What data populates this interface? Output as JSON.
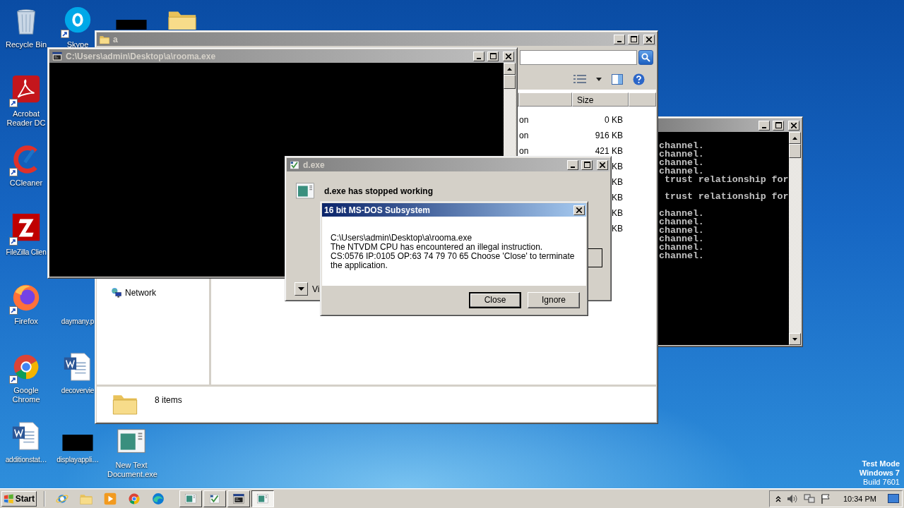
{
  "desktop_icons": [
    {
      "kind": "recycle",
      "label": "Recycle Bin",
      "shortcut": false
    },
    {
      "kind": "skype",
      "label": "Skype",
      "shortcut": true
    },
    {
      "kind": "redacted",
      "shortcut": false
    },
    {
      "kind": "folder",
      "shortcut": false
    },
    {
      "kind": "acrobat",
      "label": "Acrobat Reader DC",
      "shortcut": true
    },
    {
      "kind": "ccleaner",
      "label": "CCleaner",
      "shortcut": true
    },
    {
      "kind": "filezilla",
      "label": "FileZilla Clien",
      "shortcut": true
    },
    {
      "kind": "firefox",
      "label": "Firefox",
      "shortcut": true
    },
    {
      "kind": "none",
      "label": "daymany.p",
      "shortcut": false
    },
    {
      "kind": "chrome",
      "label": "Google Chrome",
      "shortcut": true
    },
    {
      "kind": "word",
      "label": "decovervie",
      "shortcut": false
    },
    {
      "kind": "word",
      "label": "additionstat…",
      "shortcut": false
    },
    {
      "kind": "redacted",
      "label": "displayappli…",
      "shortcut": false
    },
    {
      "kind": "exe",
      "label": "New Text Document.exe",
      "shortcut": false
    }
  ],
  "console_window": {
    "title": "C:\\Users\\admin\\Desktop\\a\\rooma.exe"
  },
  "explorer": {
    "title": "a",
    "columns": [
      {
        "label": "Size"
      }
    ],
    "rows": [
      {
        "type": "on",
        "size": "0 KB"
      },
      {
        "type": "on",
        "size": "916 KB"
      },
      {
        "type": "on",
        "size": "421 KB"
      },
      {
        "size": "KB"
      },
      {
        "size": "KB"
      },
      {
        "size": "KB"
      },
      {
        "size": "KB"
      },
      {
        "size": "KB"
      }
    ],
    "nav_items": [
      {
        "label": "Network"
      }
    ],
    "status": "8 items"
  },
  "second_console": {
    "lines": [
      {
        "text": "channel.",
        "blank_after": false
      },
      {
        "text": "channel.",
        "blank_after": false
      },
      {
        "text": "channel.",
        "blank_after": false
      },
      {
        "text": "channel.",
        "blank_after": false
      },
      {
        "text": " trust relationship for",
        "blank_after": true
      },
      {
        "text": " trust relationship for",
        "blank_after": true
      },
      {
        "text": "channel.",
        "blank_after": false
      },
      {
        "text": "channel.",
        "blank_after": false
      },
      {
        "text": "channel.",
        "blank_after": false
      },
      {
        "text": "channel.",
        "blank_after": false
      },
      {
        "text": "channel.",
        "blank_after": false
      },
      {
        "text": "channel.",
        "blank_after": false
      }
    ]
  },
  "crash_dialog": {
    "title": "d.exe",
    "heading": "d.exe has stopped working",
    "details_link": "Vi"
  },
  "ntvdm_dialog": {
    "title": "16 bit MS-DOS Subsystem",
    "message": [
      "C:\\Users\\admin\\Desktop\\a\\rooma.exe",
      "The NTVDM CPU has encountered an illegal instruction.",
      "CS:0576 IP:0105 OP:63 74 79 70 65 Choose 'Close' to terminate the application."
    ],
    "buttons": [
      {
        "label": "Close",
        "default": true
      },
      {
        "label": "Ignore",
        "default": false
      }
    ]
  },
  "os_watermark": [
    "Test Mode",
    "Windows 7",
    "Build 7601"
  ],
  "taskbar": {
    "start": "Start",
    "quick_launch": [
      {
        "kind": "ie"
      },
      {
        "kind": "folder"
      },
      {
        "kind": "media"
      },
      {
        "kind": "chrome"
      },
      {
        "kind": "edge"
      }
    ],
    "tasks": [
      {
        "kind": "exe",
        "selected": false
      },
      {
        "kind": "errorapp",
        "selected": false
      },
      {
        "kind": "console",
        "selected": false
      },
      {
        "kind": "exe",
        "selected": true
      }
    ],
    "clock": "10:34 PM"
  }
}
